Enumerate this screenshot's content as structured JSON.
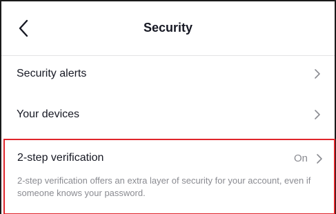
{
  "header": {
    "title": "Security",
    "back_icon": "chevron-left-icon"
  },
  "rows": [
    {
      "label": "Security alerts",
      "icon": "chevron-right-icon"
    },
    {
      "label": "Your devices",
      "icon": "chevron-right-icon"
    }
  ],
  "two_step": {
    "label": "2-step verification",
    "status": "On",
    "description": "2-step verification offers an extra layer of security for your account, even if someone knows your password.",
    "icon": "chevron-right-icon",
    "highlight_color": "#e0242a"
  },
  "colors": {
    "text": "#161823",
    "secondary_text": "#8a8b91",
    "divider": "#e3e3e4"
  }
}
